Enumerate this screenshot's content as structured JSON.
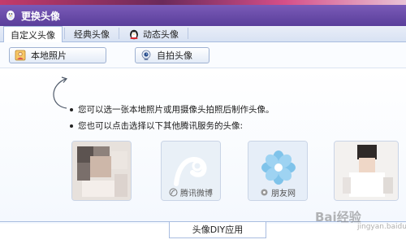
{
  "window": {
    "title": "更换头像"
  },
  "tabs": [
    {
      "label": "自定义头像",
      "active": true
    },
    {
      "label": "经典头像",
      "active": false
    },
    {
      "label": "动态头像",
      "active": false
    }
  ],
  "toolbar": {
    "local_photo_label": "本地照片",
    "selfie_label": "自拍头像"
  },
  "info": {
    "line1": "您可以选一张本地照片或用摄像头拍照后制作头像。",
    "line2": "您也可以点击选择以下其他腾讯服务的头像:"
  },
  "services": [
    {
      "caption": ""
    },
    {
      "caption": "腾讯微博"
    },
    {
      "caption": "朋友网"
    },
    {
      "caption": ""
    }
  ],
  "bottom": {
    "diy_label": "头像DIY应用"
  },
  "watermark": {
    "text": "Bai经验",
    "sub": "jingyan.baidu.com"
  },
  "colors": {
    "title_bar": "#5a3e9a",
    "tab_bar": "#d8e2f3",
    "border": "#a9bde0"
  }
}
